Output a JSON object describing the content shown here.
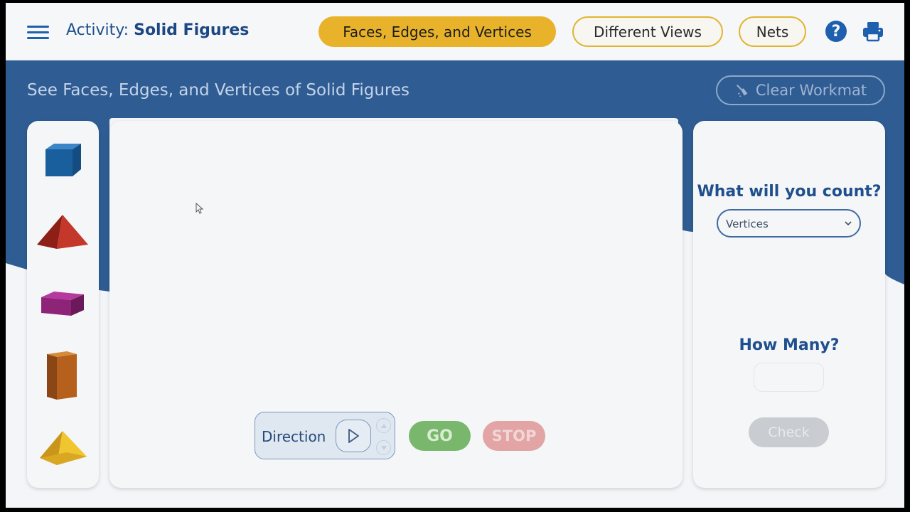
{
  "header": {
    "activity_prefix": "Activity:",
    "activity_name": "Solid Figures",
    "tabs": [
      {
        "label": "Faces, Edges, and Vertices",
        "active": true
      },
      {
        "label": "Different Views",
        "active": false
      },
      {
        "label": "Nets",
        "active": false
      }
    ],
    "help_symbol": "?",
    "icons": [
      "menu-icon",
      "help-icon",
      "print-icon"
    ]
  },
  "main": {
    "subtitle": "See Faces, Edges, and Vertices of Solid Figures",
    "clear_label": "Clear Workmat"
  },
  "shapes": [
    {
      "name": "cube",
      "color": "#1d5f9e"
    },
    {
      "name": "square-pyramid",
      "color": "#b52a1f"
    },
    {
      "name": "flat-rectangular-prism",
      "color": "#8e2478"
    },
    {
      "name": "tall-rectangular-prism",
      "color": "#b5601c"
    },
    {
      "name": "triangular-pyramid",
      "color": "#e2b321"
    }
  ],
  "controls": {
    "direction_label": "Direction",
    "go_label": "GO",
    "stop_label": "STOP"
  },
  "count_panel": {
    "question": "What will you count?",
    "selected": "Vertices",
    "how_many_label": "How Many?",
    "answer_value": "",
    "check_label": "Check"
  },
  "colors": {
    "primary_blue": "#1e5fae",
    "band_blue": "#2f5d93",
    "active_tab": "#e8b32a",
    "go_green": "#79b86c",
    "stop_red": "#e2a4a4"
  }
}
